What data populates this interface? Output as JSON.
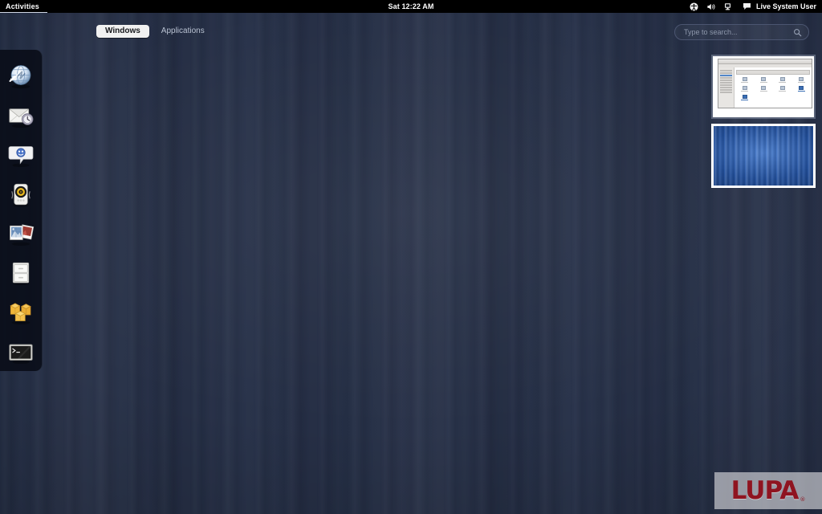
{
  "top_bar": {
    "activities_label": "Activities",
    "clock": "Sat 12:22 AM",
    "tray_icons": [
      {
        "name": "accessibility-icon",
        "title": "Universal Access"
      },
      {
        "name": "volume-icon",
        "title": "Volume"
      },
      {
        "name": "display-icon",
        "title": "Display"
      },
      {
        "name": "chat-icon",
        "title": "Messaging"
      }
    ],
    "user_name": "Live System User"
  },
  "view_selector": {
    "tabs": [
      {
        "label": "Windows",
        "active": true
      },
      {
        "label": "Applications",
        "active": false
      }
    ]
  },
  "search": {
    "placeholder": "Type to search...",
    "value": "",
    "icon": "search-icon"
  },
  "dash": {
    "items": [
      {
        "name": "web-browser",
        "label": "Web Browser"
      },
      {
        "name": "email-client",
        "label": "Evolution Mail"
      },
      {
        "name": "instant-messenger",
        "label": "Empathy Chat"
      },
      {
        "name": "music-player",
        "label": "Rhythmbox Music Player"
      },
      {
        "name": "photo-manager",
        "label": "Shotwell Photo Manager"
      },
      {
        "name": "file-manager",
        "label": "Files"
      },
      {
        "name": "package-manager",
        "label": "Add/Remove Software"
      },
      {
        "name": "terminal",
        "label": "Terminal"
      }
    ]
  },
  "workspaces": {
    "items": [
      {
        "name": "workspace-1",
        "label": "Workspace 1",
        "active": false,
        "has_window": true,
        "window_title": "File Manager"
      },
      {
        "name": "workspace-2",
        "label": "Workspace 2",
        "active": true,
        "has_window": false,
        "window_title": ""
      }
    ]
  },
  "watermark": {
    "text": "LUPA",
    "registered": "®"
  },
  "colors": {
    "top_bar_bg": "#000000",
    "overview_bg": "#252f47",
    "dash_bg": "#080c16",
    "accent_white": "#ffffff",
    "tab_active_bg": "#f1f1f1",
    "search_border": "#4b5570",
    "watermark_red": "#8f1420",
    "workspace_blue": "#1d4e9b"
  }
}
